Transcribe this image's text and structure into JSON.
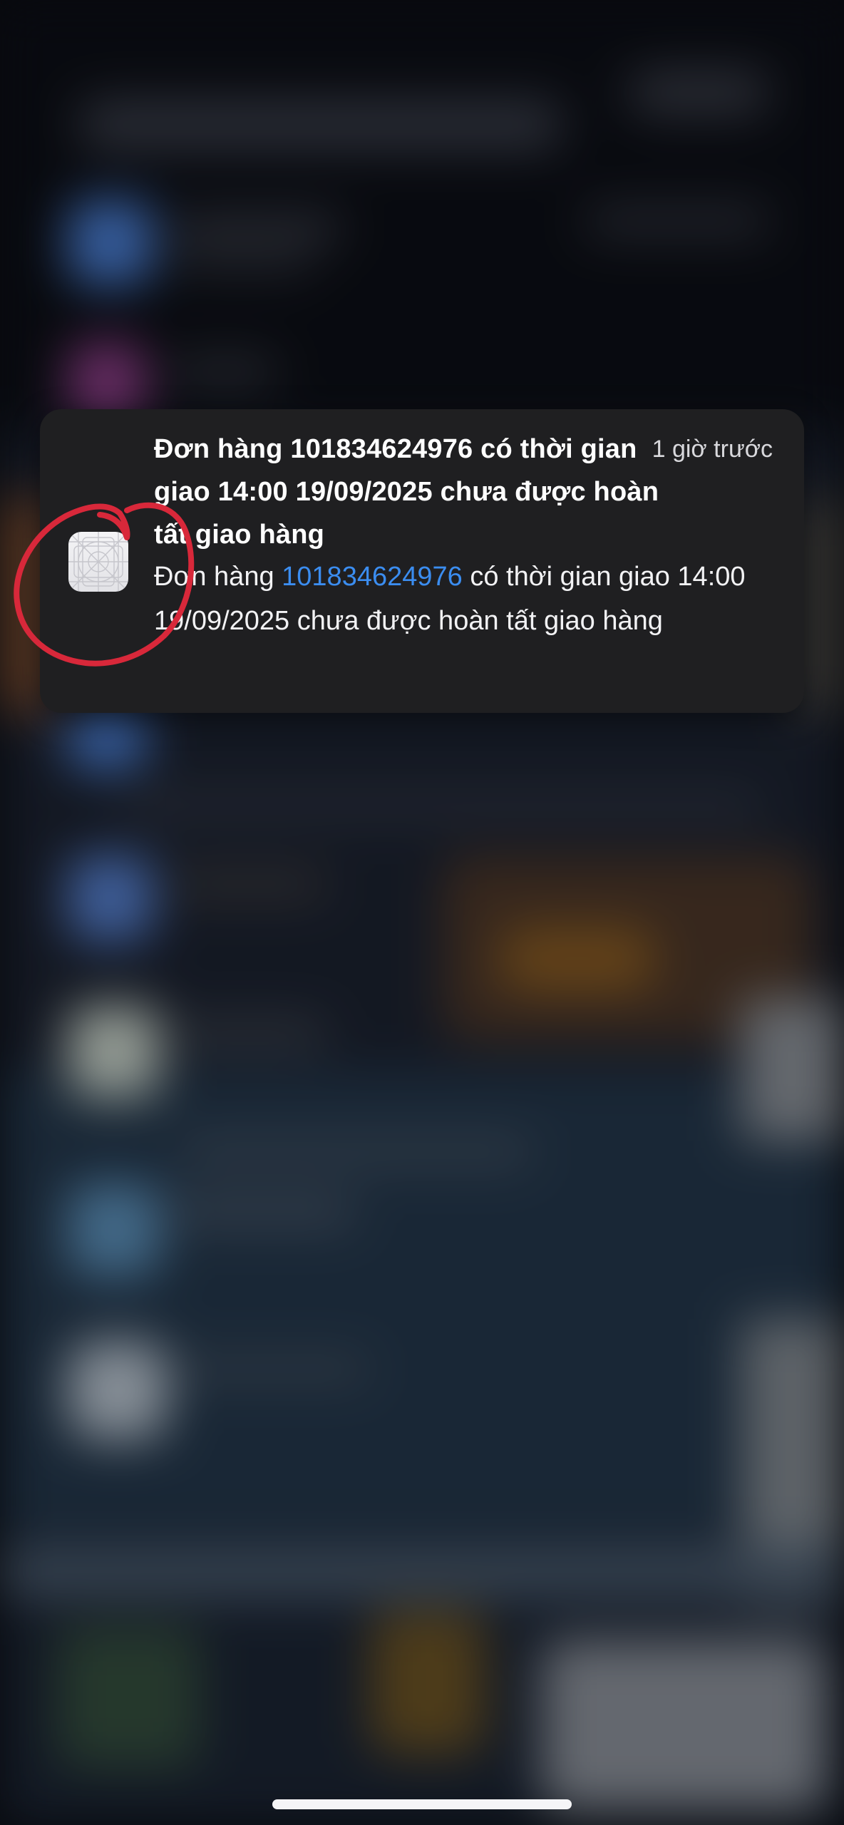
{
  "notification": {
    "title": "Đơn hàng 101834624976 có thời gian giao 14:00 19/09/2025 chưa được hoàn tất giao hàng",
    "time": "1 giờ trước",
    "body_prefix": "Đơn hàng ",
    "body_order_number": "101834624976",
    "body_suffix": " có thời gian giao 14:00 19/09/2025 chưa được hoàn tất giao hàng",
    "app_icon": "placeholder-app-icon",
    "link_color": "#3b8df0"
  },
  "annotation": {
    "shape": "hand-drawn circle around app icon",
    "color": "#d8283a"
  },
  "home_indicator": {
    "icon": "home-indicator-bar"
  }
}
